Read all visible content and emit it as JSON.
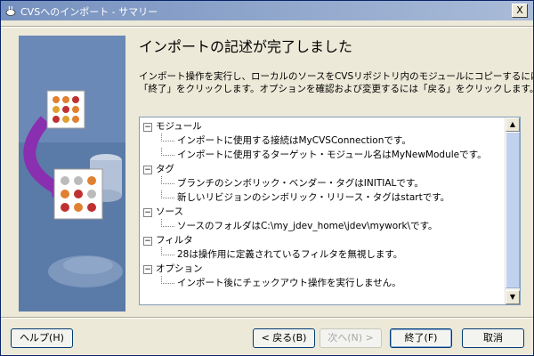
{
  "window": {
    "title": "CVSへのインポート - サマリー",
    "close_label": "X"
  },
  "heading": "インポートの記述が完了しました",
  "description": [
    "インポート操作を実行し、ローカルのソースをCVSリポジトリ内のモジュールにコピーするには",
    "「終了」をクリックします。オプションを確認および変更するには「戻る」をクリックします。"
  ],
  "tree": {
    "collapse_glyph": "−",
    "items": [
      {
        "label": "モジュール",
        "children": [
          "インポートに使用する接続はMyCVSConnectionです。",
          "インポートに使用するターゲット・モジュール名はMyNewModuleです。"
        ]
      },
      {
        "label": "タグ",
        "children": [
          "ブランチのシンボリック・ベンダー・タグはINITIALです。",
          "新しいリビジョンのシンボリック・リリース・タグはstartです。"
        ]
      },
      {
        "label": "ソース",
        "children": [
          "ソースのフォルダはC:\\my_jdev_home\\jdev\\mywork\\です。"
        ]
      },
      {
        "label": "フィルタ",
        "children": [
          "28は操作用に定義されているフィルタを無視します。"
        ]
      },
      {
        "label": "オプション",
        "children": [
          "インポート後にチェックアウト操作を実行しません。"
        ]
      }
    ]
  },
  "buttons": {
    "help": "ヘルプ(H)",
    "back": "< 戻る(B)",
    "next": "次へ(N) >",
    "finish": "終了(F)",
    "cancel": "取消"
  },
  "colors": {
    "title_bar": "#7691bf",
    "banner": "#5a7aa8",
    "tree_border": "#7f9db9"
  }
}
